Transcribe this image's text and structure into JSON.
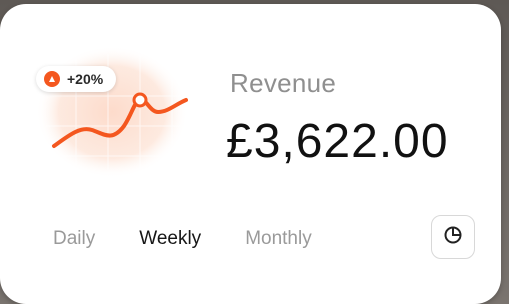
{
  "widget": {
    "trend_badge": "+20%",
    "title": "Revenue",
    "amount": "£3,622.00",
    "accent_color": "#f4571f"
  },
  "periods": [
    {
      "label": "Daily",
      "active": false
    },
    {
      "label": "Weekly",
      "active": true
    },
    {
      "label": "Monthly",
      "active": false
    }
  ],
  "chart_button": {
    "icon": "pie-chart-icon"
  }
}
